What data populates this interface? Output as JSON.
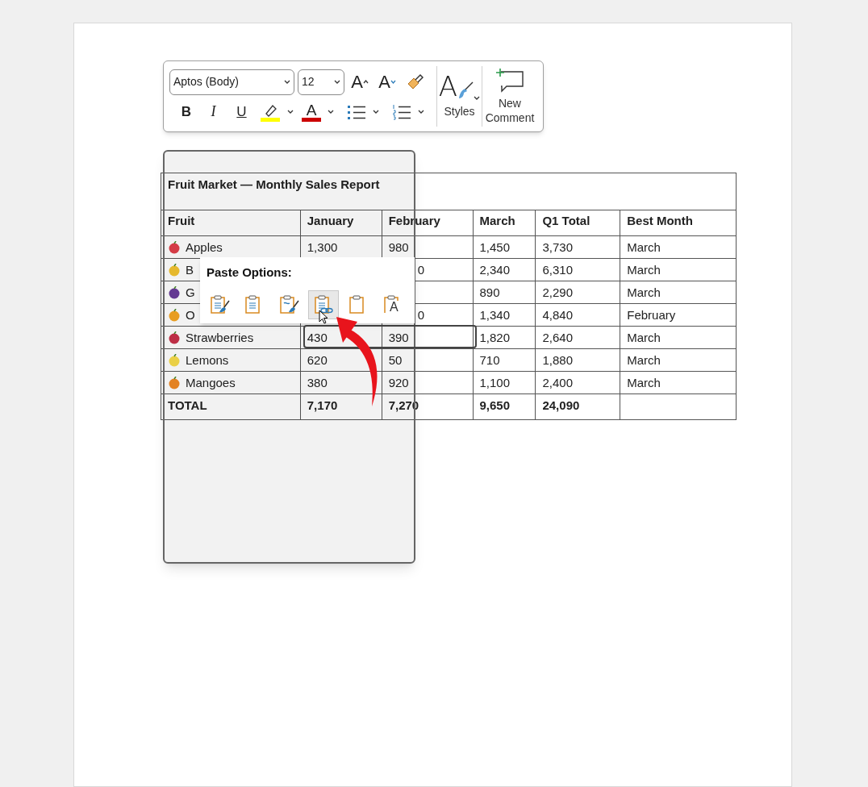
{
  "mini_toolbar": {
    "font_field": "Aptos (Body)",
    "size_field": "12",
    "top_buttons": [
      {
        "kind": "grow",
        "label": "A"
      },
      {
        "kind": "shrink",
        "label": "A"
      },
      {
        "kind": "painter"
      }
    ],
    "format_buttons": [
      {
        "kind": "bold",
        "label": "B"
      },
      {
        "kind": "italic",
        "label": "I"
      },
      {
        "kind": "underline",
        "label": "U"
      },
      {
        "kind": "highlight",
        "color": "#ffff00"
      },
      {
        "kind": "font-color",
        "label": "A",
        "color": "#cc0000"
      },
      {
        "kind": "bullets"
      },
      {
        "kind": "numbering"
      }
    ],
    "styles": {
      "glyph": "A",
      "label": "Styles"
    },
    "comment": {
      "label": "New Comment"
    }
  },
  "table": {
    "title": "Fruit Market — Monthly Sales Report",
    "columns": [
      "Fruit",
      "January",
      "February",
      "March",
      "Q1 Total",
      "Best Month"
    ],
    "rows": [
      {
        "kind": "row",
        "color": "#e0404a",
        "cells": [
          "Apples",
          "1,300",
          "980",
          "1,450",
          "3,730",
          "March"
        ]
      },
      {
        "kind": "covered",
        "color": "#f2c230",
        "cells": [
          "B",
          null,
          "0",
          "2,340",
          "6,310",
          "March"
        ]
      },
      {
        "kind": "covered",
        "color": "#6a3d9a",
        "cells": [
          "G",
          null,
          null,
          "890",
          "2,290",
          "March"
        ]
      },
      {
        "kind": "covered",
        "color": "#f5a623",
        "cells": [
          "O",
          null,
          "0",
          "1,340",
          "4,840",
          "February"
        ]
      },
      {
        "kind": "row",
        "color": "#c8324a",
        "cells": [
          "Strawberries",
          "430",
          "390",
          "1,820",
          "2,640",
          "March"
        ]
      },
      {
        "kind": "row",
        "color": "#f7dc4a",
        "cells": [
          "Lemons",
          "620",
          "50",
          "710",
          "1,880",
          "March"
        ]
      },
      {
        "kind": "row",
        "color": "#f08a24",
        "cells": [
          "Mangoes",
          "380",
          "920",
          "1,100",
          "2,400",
          "March"
        ]
      },
      {
        "kind": "total",
        "cells": [
          "TOTAL",
          "7,170",
          "7,270",
          "9,650",
          "24,090",
          null
        ]
      }
    ]
  },
  "paste_options": {
    "title": "Paste Options:",
    "options": [
      {
        "kind": "brush",
        "selected": false
      },
      {
        "kind": "lines",
        "selected": false
      },
      {
        "kind": "merge",
        "selected": false
      },
      {
        "kind": "link",
        "selected": true
      },
      {
        "kind": "picture",
        "selected": false
      },
      {
        "kind": "letter",
        "letter": "A",
        "selected": false
      }
    ]
  }
}
